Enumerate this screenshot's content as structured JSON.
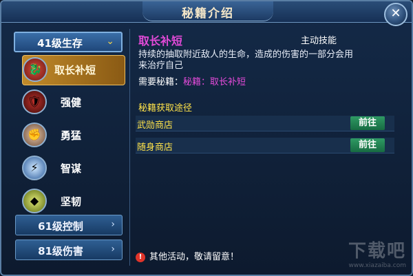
{
  "window": {
    "title": "秘籍介绍",
    "close_label": "✕"
  },
  "sidebar": {
    "header": {
      "label": "41级生存",
      "arrow": "⌄"
    },
    "skills": [
      {
        "label": "取长补短",
        "icon": "red-serpent-icon",
        "glyph": "🐉",
        "selected": true
      },
      {
        "label": "强健",
        "icon": "armored-body-icon",
        "glyph": "🛡"
      },
      {
        "label": "勇猛",
        "icon": "fist-icon",
        "glyph": "✊"
      },
      {
        "label": "智谋",
        "icon": "lightning-orb-icon",
        "glyph": "⚡"
      },
      {
        "label": "坚韧",
        "icon": "green-gem-icon",
        "glyph": "◆"
      }
    ],
    "groups": [
      {
        "label": "61级控制",
        "arrow": "›"
      },
      {
        "label": "81级伤害",
        "arrow": "›"
      }
    ]
  },
  "detail": {
    "name": "取长补短",
    "type": "主动技能",
    "description": "持续的抽取附近敌人的生命，造成的伤害的一部分会用来治疗自己",
    "requirement_label": "需要秘籍：",
    "requirement_value": "秘籍：取长补短",
    "sources_title": "秘籍获取途径",
    "sources": [
      {
        "name": "武勋商店",
        "action": "前往"
      },
      {
        "name": "随身商店",
        "action": "前往"
      }
    ],
    "notice": "其他活动，敬请留意！",
    "notice_icon": "!"
  },
  "watermark": {
    "text": "下载吧",
    "sub": "www.xiazaiba.com"
  },
  "colors": {
    "accent_magenta": "#e24ad8",
    "accent_yellow": "#ffe34a",
    "go_green": "#2f9a64"
  }
}
